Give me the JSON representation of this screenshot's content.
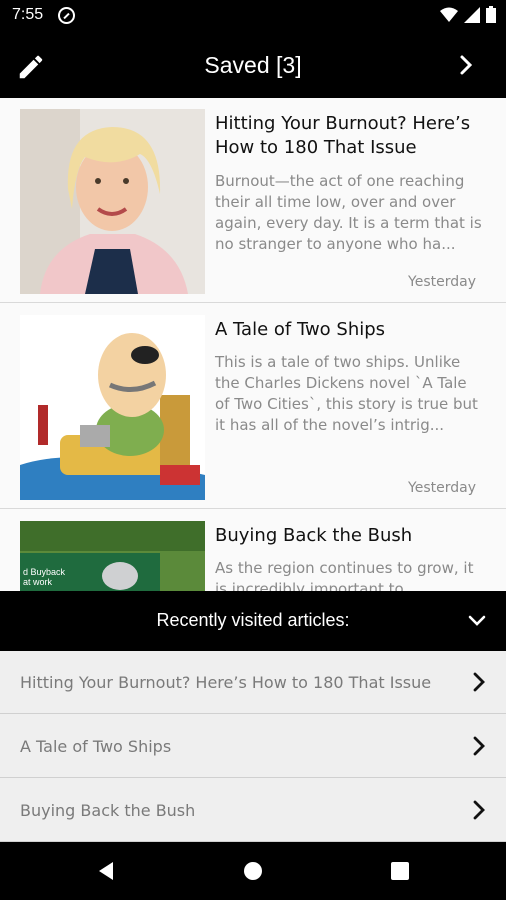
{
  "status_bar": {
    "time": "7:55",
    "icons": [
      "sync-icon",
      "wifi-icon",
      "signal-icon",
      "battery-icon"
    ]
  },
  "app_bar": {
    "title": "Saved [3]",
    "left_icon": "pencil-icon",
    "right_icon": "chevron-right-icon"
  },
  "articles": [
    {
      "title": "Hitting Your Burnout? Here’s How to 180 That Issue",
      "snippet": "Burnout—the act of one reaching their all time low, over and over again, every day.  It is a term that is no stranger to anyone who ha...",
      "date": "Yesterday"
    },
    {
      "title": "A Tale of Two Ships",
      "snippet": "This is a tale of two ships. Unlike the Charles Dickens novel `A Tale of Two Cities`, this story is true but it has all of the novel’s intrig...",
      "date": "Yesterday"
    },
    {
      "title": "Buying Back  the Bush",
      "snippet": "As  the region continues to grow, it is incredibly important to",
      "date": "",
      "thumb_text": "d Buyback\nat work"
    }
  ],
  "recent": {
    "header": "Recently visited articles:",
    "items": [
      "Hitting Your Burnout? Here’s How to 180 That Issue",
      "A Tale of Two Ships",
      "Buying Back  the Bush"
    ]
  },
  "colors": {
    "bar": "#000000",
    "list_bg": "#fafafa",
    "recent_bg": "#efefef",
    "muted_text": "#8a8a8a"
  }
}
